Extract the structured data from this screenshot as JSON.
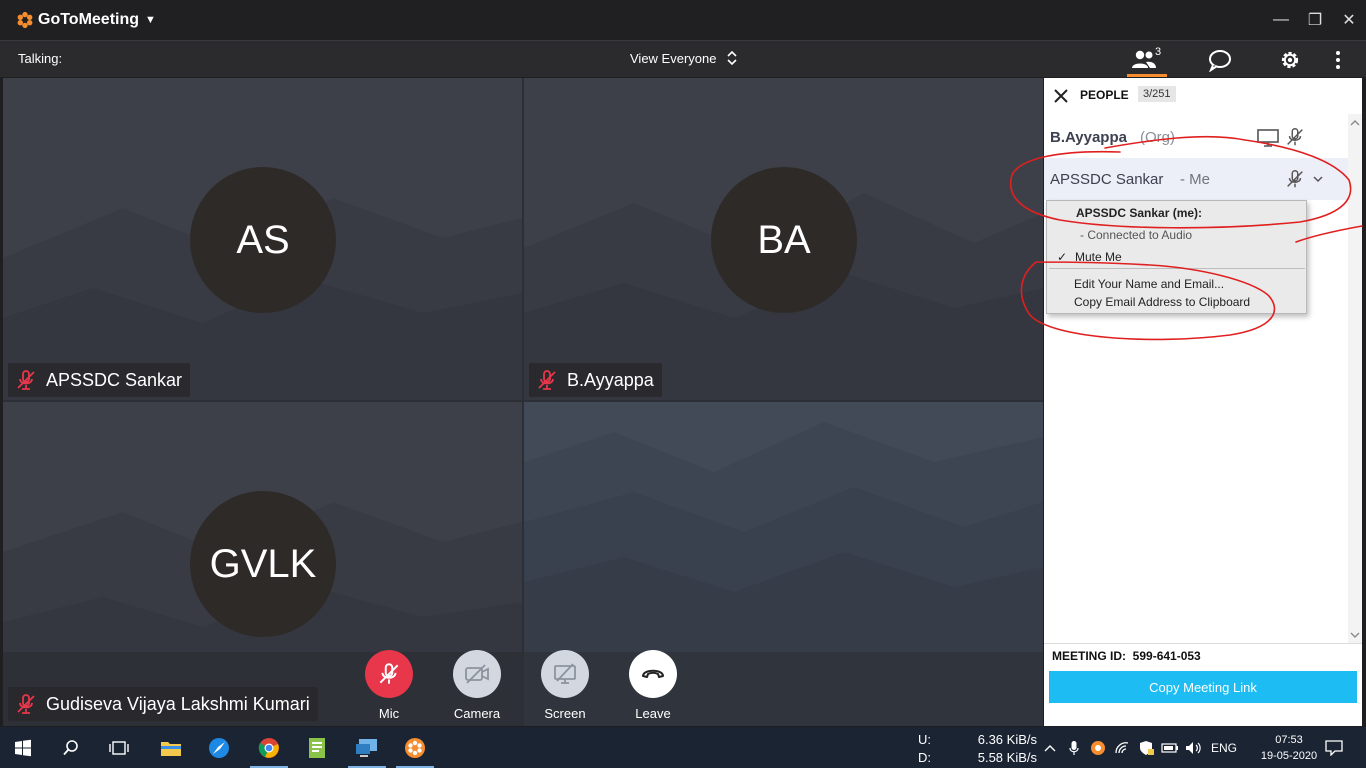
{
  "app": {
    "brand": "GoToMeeting"
  },
  "toolbar": {
    "talking_label": "Talking:",
    "view_label": "View Everyone",
    "people_count": "3"
  },
  "tiles": [
    {
      "initials": "AS",
      "name": "APSSDC Sankar"
    },
    {
      "initials": "BA",
      "name": "B.Ayyappa"
    },
    {
      "initials": "GVLK",
      "name": "Gudiseva Vijaya Lakshmi Kumari"
    }
  ],
  "controls": {
    "mic": "Mic",
    "camera": "Camera",
    "screen": "Screen",
    "leave": "Leave"
  },
  "sidebar": {
    "title": "PEOPLE",
    "count": "3/251",
    "people": [
      {
        "name": "B.Ayyappa",
        "tag": "(Org)"
      },
      {
        "name": "APSSDC Sankar",
        "tag": "- Me"
      }
    ],
    "meeting_id_label": "MEETING ID:",
    "meeting_id": "599-641-053",
    "copy_link": "Copy Meeting Link"
  },
  "menu": {
    "header": "APSSDC Sankar (me):",
    "connected": "- Connected to Audio",
    "mute_check": "✓",
    "mute": "Mute Me",
    "edit": "Edit Your Name and Email...",
    "copy_email": "Copy Email Address to Clipboard"
  },
  "taskbar": {
    "upload_label": "U:",
    "download_label": "D:",
    "upload_rate": "6.36 KiB/s",
    "download_rate": "5.58 KiB/s",
    "lang": "ENG",
    "time": "07:53",
    "date": "19-05-2020"
  },
  "colors": {
    "accent": "#f68d2e",
    "mic_off": "#e8374a",
    "link_button": "#1dbcf2",
    "annotation": "#e02020"
  },
  "icons": [
    "people-icon",
    "chat-icon",
    "gear-icon",
    "more-icon",
    "mic-off-icon",
    "camera-off-icon",
    "screen-share-icon",
    "hangup-icon",
    "close-icon",
    "monitor-icon",
    "chevron-down-icon"
  ]
}
